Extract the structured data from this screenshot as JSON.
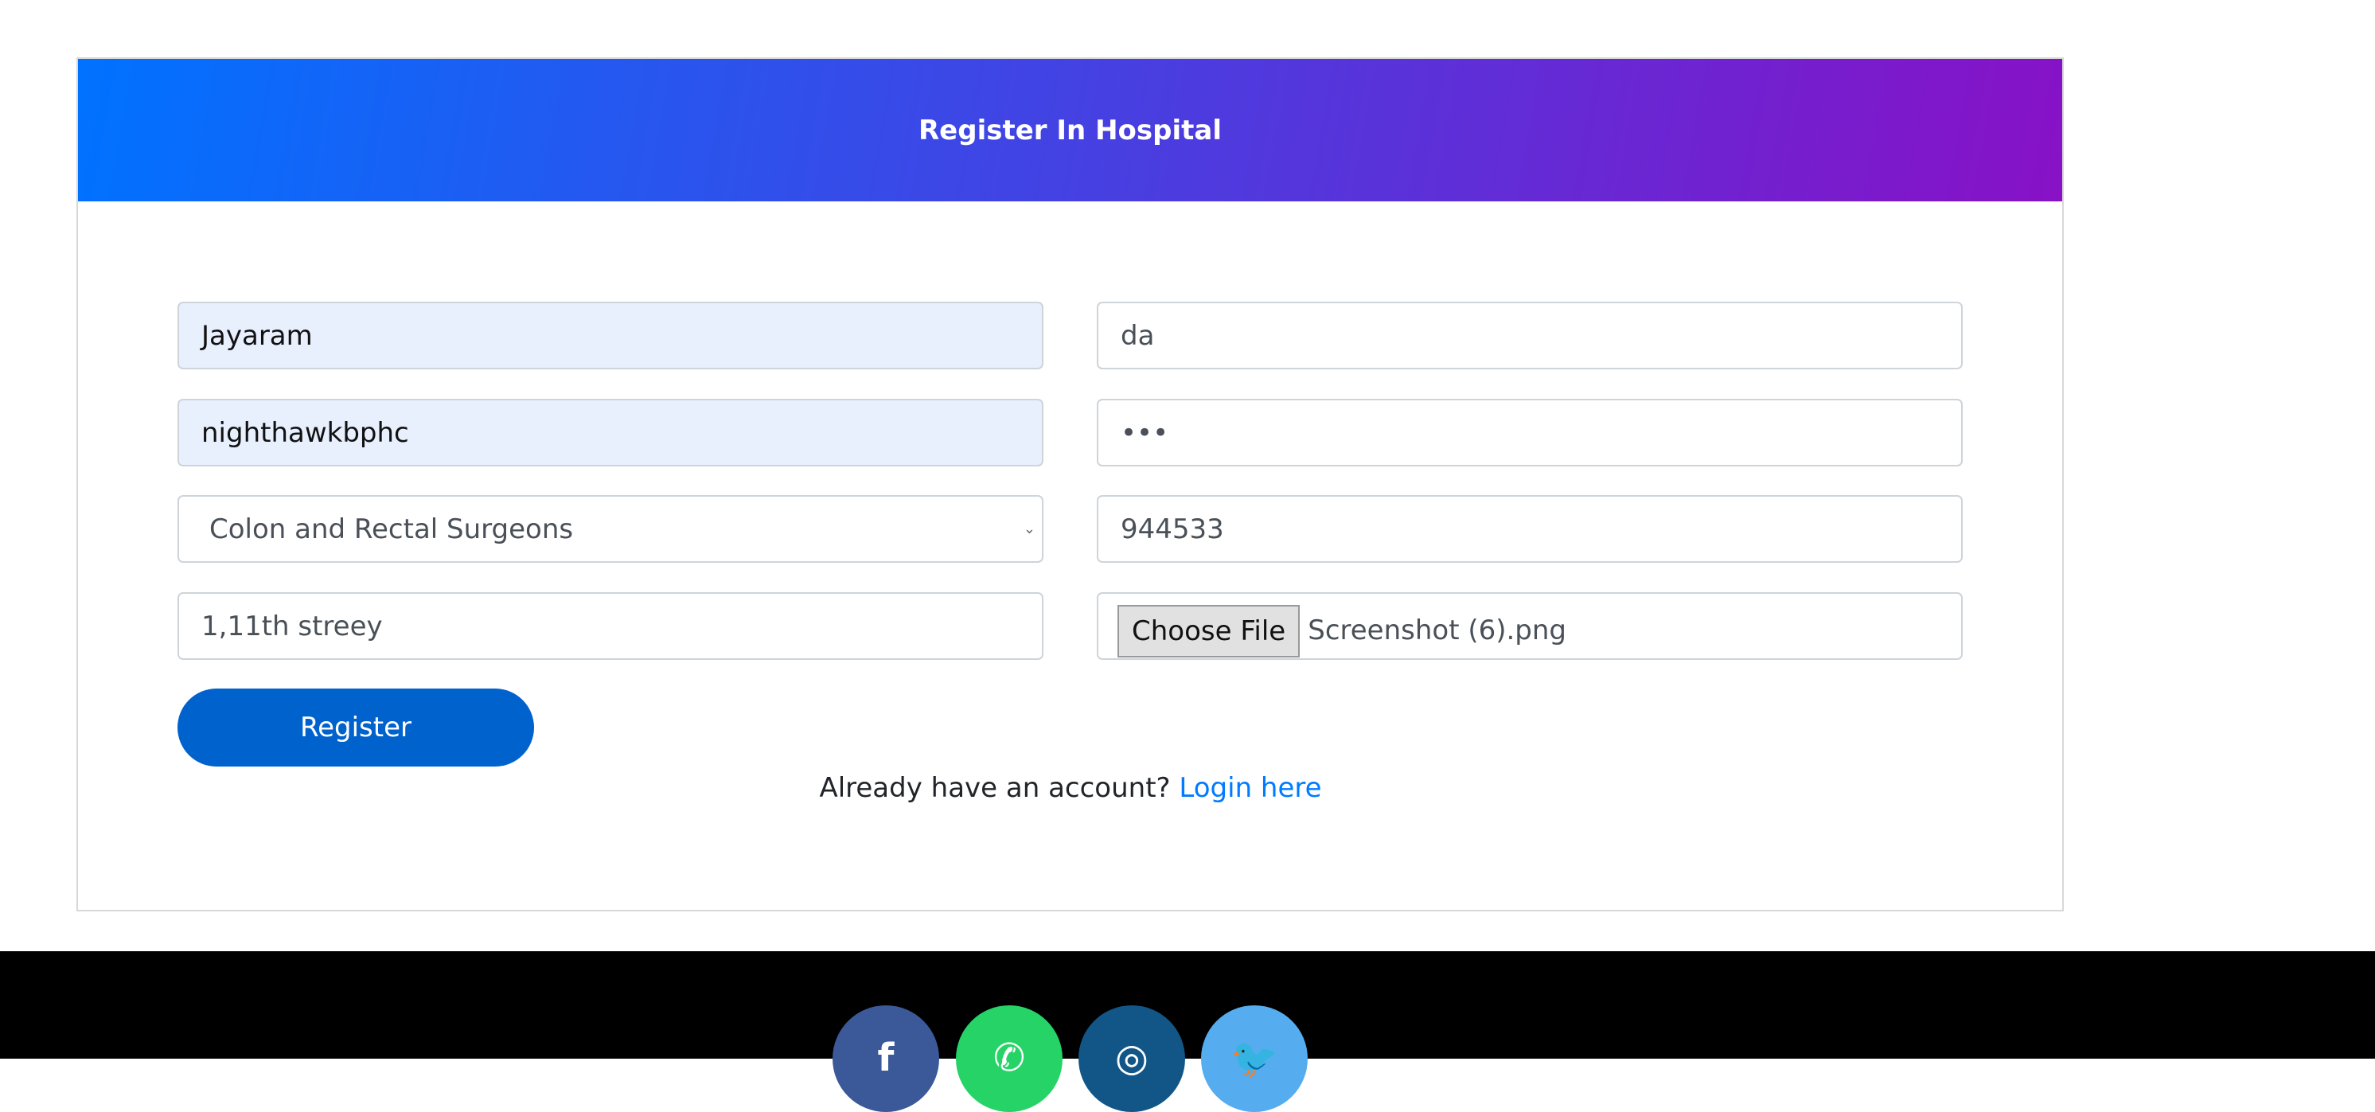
{
  "header": {
    "title": "Register In Hospital",
    "gradient": [
      "#0072ff",
      "#8811c6"
    ]
  },
  "form": {
    "name": "Jayaram",
    "field2": "da",
    "username": "nighthawkbphc",
    "password_mask": "•••",
    "specialty": "Colon and Rectal Surgeons",
    "phone": "944533",
    "address": "1,11th streey",
    "file_button": "Choose File",
    "file_name": "Screenshot (6).png",
    "register": "Register",
    "login_prompt": "Already have an account?",
    "login_link": "Login here"
  },
  "footer": {
    "social": [
      {
        "icon": "facebook-icon",
        "glyph": "f",
        "color": "#3b5998"
      },
      {
        "icon": "whatsapp-icon",
        "glyph": "✆",
        "color": "#25d366"
      },
      {
        "icon": "instagram-icon",
        "glyph": "◎",
        "color": "#125688"
      },
      {
        "icon": "twitter-icon",
        "glyph": "🐦",
        "color": "#55acee"
      }
    ]
  }
}
